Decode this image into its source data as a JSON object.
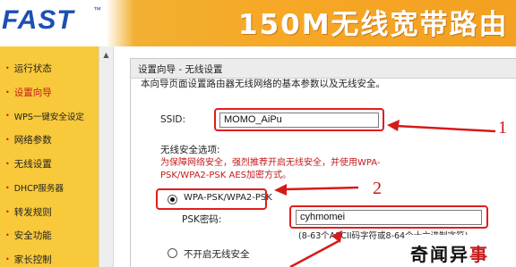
{
  "header": {
    "logo": "FAST",
    "logo_mark": "™",
    "product_title": "150M无线宽带路由"
  },
  "sidebar": {
    "items": [
      {
        "label": "运行状态",
        "active": false
      },
      {
        "label": "设置向导",
        "active": true
      },
      {
        "label": "WPS一键安全设定",
        "active": false
      },
      {
        "label": "网络参数",
        "active": false
      },
      {
        "label": "无线设置",
        "active": false
      },
      {
        "label": "DHCP服务器",
        "active": false
      },
      {
        "label": "转发规则",
        "active": false
      },
      {
        "label": "安全功能",
        "active": false
      },
      {
        "label": "家长控制",
        "active": false
      }
    ]
  },
  "panel": {
    "title": "设置向导 - 无线设置",
    "intro": "本向导页面设置路由器无线网络的基本参数以及无线安全。",
    "ssid_label": "SSID:",
    "ssid_value": "MOMO_AiPu",
    "security_label": "无线安全选项:",
    "security_warning": "为保障网络安全，强烈推荐开启无线安全，并使用WPA-PSK/WPA2-PSK AES加密方式。",
    "option_wpa": "WPA-PSK/WPA2-PSK",
    "psk_label": "PSK密码:",
    "psk_value": "cyhmomei",
    "psk_hint": "(8-63个ASCII码字符或8-64个十六进制字符)",
    "option_none": "不开启无线安全"
  },
  "annotations": [
    "1",
    "2"
  ],
  "watermark": {
    "text1": "奇闻异",
    "text2": "事"
  }
}
